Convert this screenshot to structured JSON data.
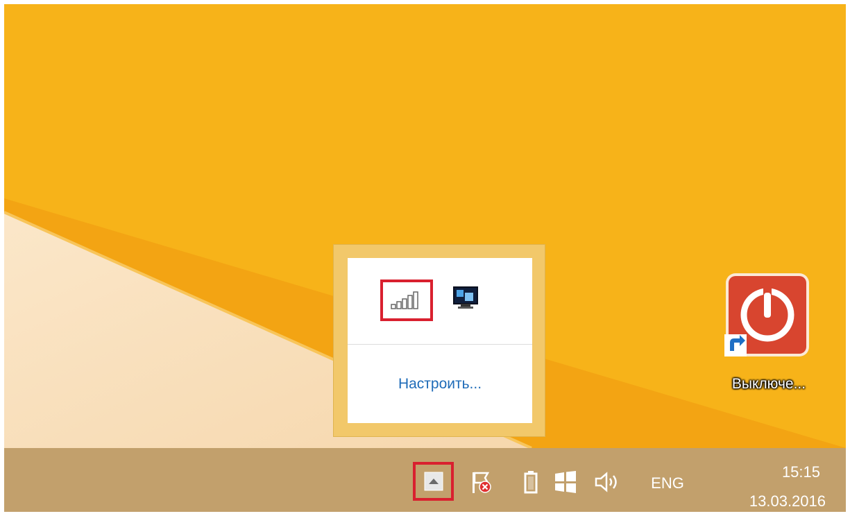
{
  "tray_popup": {
    "icons": [
      "signal-strength-icon",
      "network-monitor-icon"
    ],
    "customize_link": "Настроить..."
  },
  "desktop": {
    "shortcut": {
      "icon": "power-button-icon",
      "label": "Выключе..."
    }
  },
  "taskbar": {
    "tray_icons": [
      "show-hidden-icons-chevron",
      "action-center-flag-icon",
      "battery-icon",
      "windows-icon",
      "speaker-icon"
    ],
    "language": "ENG",
    "clock": {
      "time": "15:15",
      "date": "13.03.2016"
    }
  },
  "colors": {
    "wallpaper_yellow": "#f7b319",
    "taskbar": "#c2a06c",
    "highlight_red": "#d9202f",
    "link_blue": "#1e6bb8"
  }
}
